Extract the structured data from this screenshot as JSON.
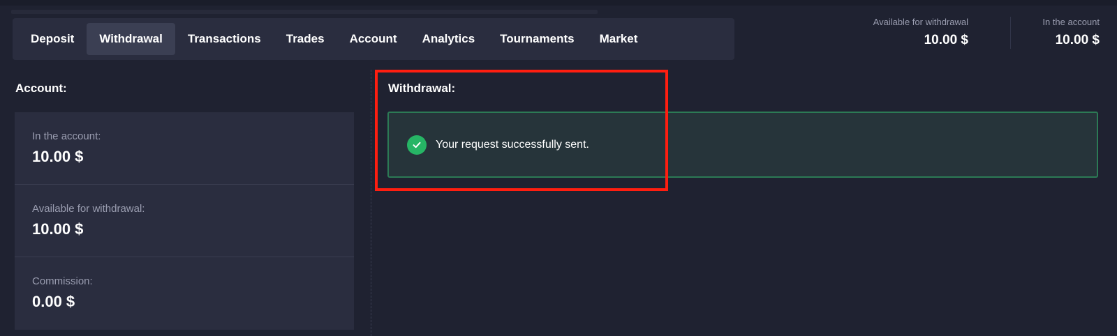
{
  "tabs": [
    {
      "label": "Deposit",
      "active": false
    },
    {
      "label": "Withdrawal",
      "active": true
    },
    {
      "label": "Transactions",
      "active": false
    },
    {
      "label": "Trades",
      "active": false
    },
    {
      "label": "Account",
      "active": false
    },
    {
      "label": "Analytics",
      "active": false
    },
    {
      "label": "Tournaments",
      "active": false
    },
    {
      "label": "Market",
      "active": false
    }
  ],
  "header_balances": {
    "available": {
      "label": "Available for withdrawal",
      "value": "10.00 $"
    },
    "account": {
      "label": "In the account",
      "value": "10.00 $"
    }
  },
  "account_section": {
    "title": "Account:",
    "rows": [
      {
        "label": "In the account:",
        "value": "10.00 $"
      },
      {
        "label": "Available for withdrawal:",
        "value": "10.00 $"
      },
      {
        "label": "Commission:",
        "value": "0.00 $"
      }
    ]
  },
  "withdrawal_section": {
    "title": "Withdrawal:",
    "message": "Your request successfully sent.",
    "message_icon": "check-circle-icon"
  },
  "colors": {
    "background": "#1f2231",
    "panel": "#2a2d3f",
    "active_tab": "#3b3f53",
    "success_border": "#2c7a55",
    "success_icon": "#26b565",
    "highlight": "#ff1e10"
  }
}
